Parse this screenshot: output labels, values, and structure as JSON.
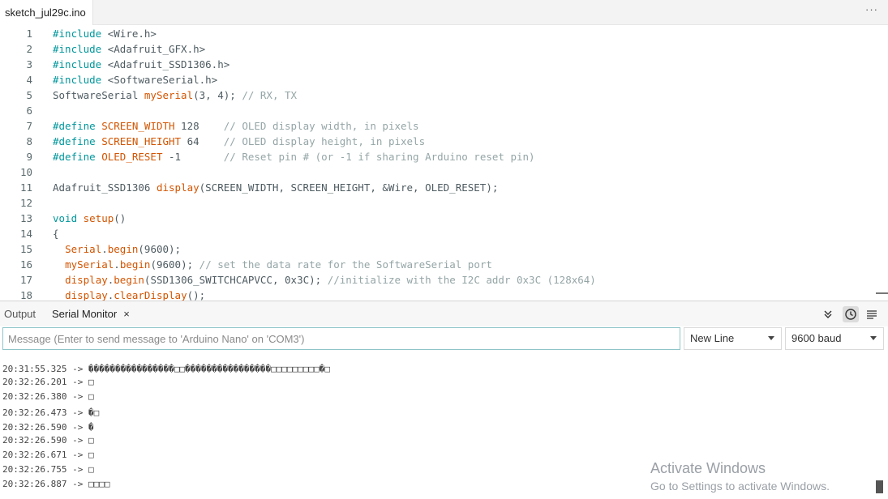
{
  "tab": {
    "filename": "sketch_jul29c.ino",
    "more": "···"
  },
  "editor": {
    "line_numbers": [
      "1",
      "2",
      "3",
      "4",
      "5",
      "6",
      "7",
      "8",
      "9",
      "10",
      "11",
      "12",
      "13",
      "14",
      "15",
      "16",
      "17",
      "18"
    ],
    "lines": [
      "#include <Wire.h>",
      "#include <Adafruit_GFX.h>",
      "#include <Adafruit_SSD1306.h>",
      "#include <SoftwareSerial.h>",
      "SoftwareSerial mySerial(3, 4); // RX, TX",
      "",
      "#define SCREEN_WIDTH 128    // OLED display width, in pixels",
      "#define SCREEN_HEIGHT 64    // OLED display height, in pixels",
      "#define OLED_RESET -1       // Reset pin # (or -1 if sharing Arduino reset pin)",
      "",
      "Adafruit_SSD1306 display(SCREEN_WIDTH, SCREEN_HEIGHT, &Wire, OLED_RESET);",
      "",
      "void setup()",
      "{",
      "  Serial.begin(9600);",
      "  mySerial.begin(9600); // set the data rate for the SoftwareSerial port",
      "  display.begin(SSD1306_SWITCHCAPVCC, 0x3C); //initialize with the I2C addr 0x3C (128x64)",
      "  display.clearDisplay();"
    ]
  },
  "panel": {
    "tabs": [
      "Output",
      "Serial Monitor"
    ],
    "close": "×",
    "icons": [
      "chevron-double-down-icon",
      "clock-icon",
      "lines-icon"
    ]
  },
  "serial": {
    "placeholder": "Message (Enter to send message to 'Arduino Nano' on 'COM3')",
    "line_ending": "New Line",
    "baud": "9600 baud",
    "output": [
      "20:31:55.325 -> ����������������□□����������������□□□□□□□□□�□",
      "20:32:26.201 -> □",
      "20:32:26.380 -> □",
      "20:32:26.473 -> �□",
      "20:32:26.590 -> �",
      "20:32:26.590 -> □",
      "20:32:26.671 -> □",
      "20:32:26.755 -> □",
      "20:32:26.887 -> □□□□"
    ]
  },
  "watermark": {
    "title": "Activate Windows",
    "subtitle": "Go to Settings to activate Windows."
  }
}
